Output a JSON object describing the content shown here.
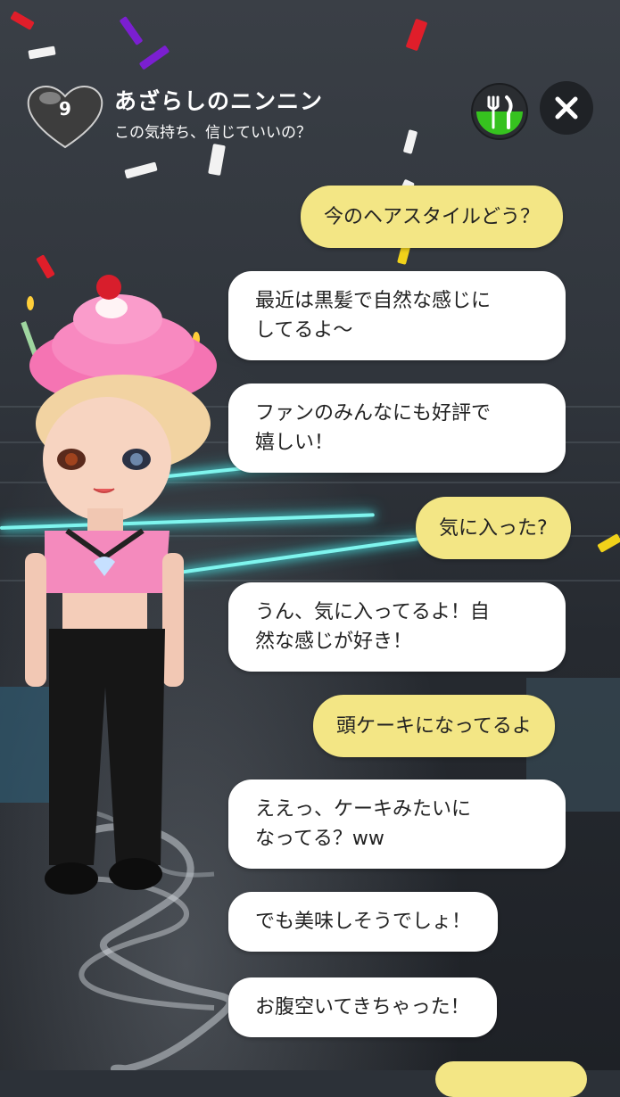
{
  "header": {
    "affection_level": "9",
    "character_name": "あざらしのニンニン",
    "subtitle": "この気持ち、信じていいの？",
    "food_icon": "fork-knife-icon",
    "close_icon": "close-icon"
  },
  "messages": [
    {
      "sender": "user",
      "text": "今のヘアスタイルどう？"
    },
    {
      "sender": "bot",
      "line1": "最近は黒髪で自然な感じに",
      "line2": "してるよ〜"
    },
    {
      "sender": "bot",
      "line1": "ファンのみんなにも好評で",
      "line2": "嬉しい！"
    },
    {
      "sender": "user",
      "text": "気に入った?"
    },
    {
      "sender": "bot",
      "line1": "うん、気に入ってるよ！自",
      "line2": "然な感じが好き！"
    },
    {
      "sender": "user",
      "text": "頭ケーキになってるよ"
    },
    {
      "sender": "bot",
      "line1": "ええっ、ケーキみたいに",
      "line2": "なってる？ww"
    },
    {
      "sender": "bot",
      "text": "でも美味しそうでしょ！"
    },
    {
      "sender": "bot",
      "text": "お腹空いてきちゃった！"
    }
  ],
  "colors": {
    "user_bubble": "#f3e685",
    "bot_bubble": "#ffffff",
    "food_button_accent": "#36c21f"
  }
}
